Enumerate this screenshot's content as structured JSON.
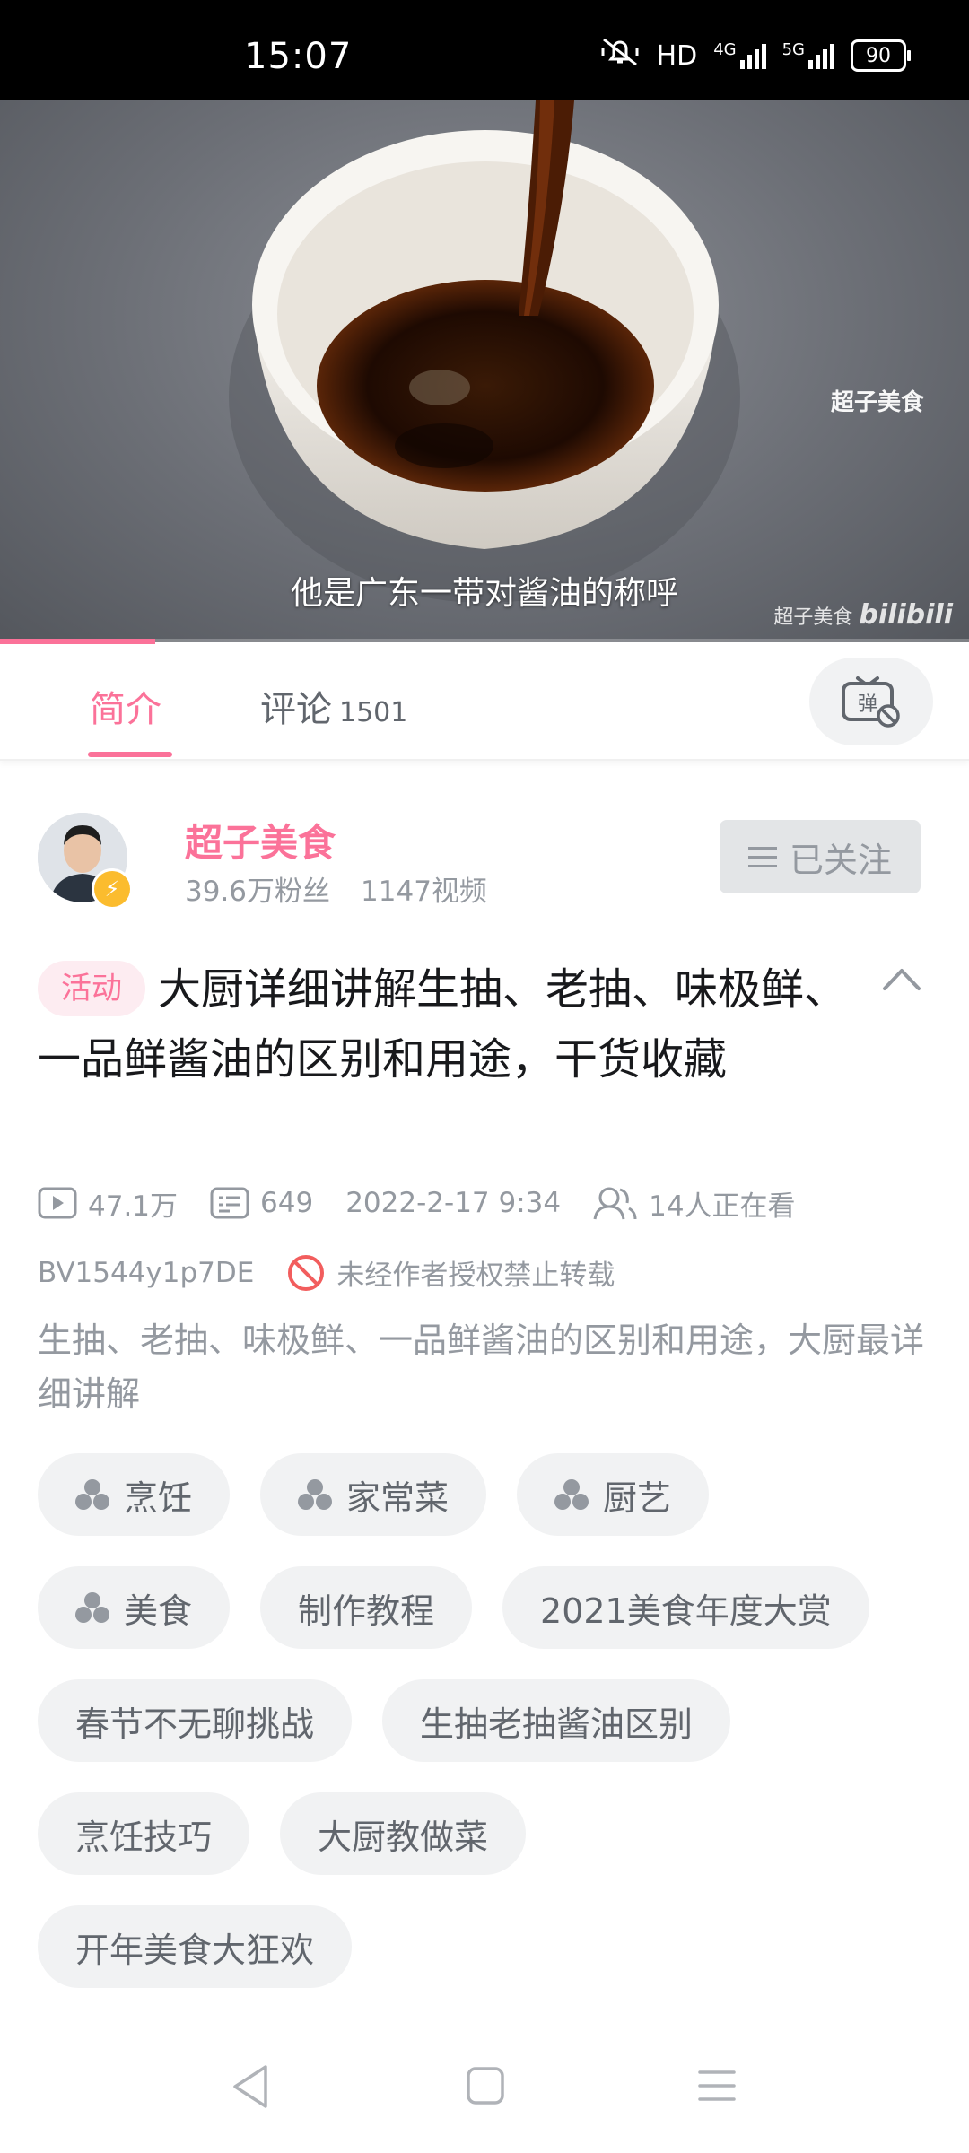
{
  "status_bar": {
    "time": "15:07",
    "hd_label": "HD",
    "network_4g": "4G",
    "network_5g": "5G",
    "battery": "90",
    "icons": [
      "mute-bell-icon",
      "hd-icon",
      "signal-4g-icon",
      "signal-5g-icon",
      "battery-icon"
    ]
  },
  "video": {
    "subtitle": "他是广东一带对酱油的称呼",
    "watermark_top": "超子美食",
    "watermark_bottom_text": "超子美食",
    "watermark_bottom_logo": "bilibili",
    "progress_fraction": 0.16
  },
  "tabs": {
    "intro": "简介",
    "comments": "评论",
    "comments_count": "1501",
    "danmaku_icon": "danmaku-off-icon"
  },
  "uploader": {
    "name": "超子美食",
    "fans": "39.6万粉丝",
    "videos": "1147视频",
    "follow_label": "已关注"
  },
  "video_info": {
    "badge": "活动",
    "title": "大厨详细讲解生抽、老抽、味极鲜、一品鲜酱油的区别和用途，干货收藏",
    "plays": "47.1万",
    "danmaku": "649",
    "date": "2022-2-17 9:34",
    "watching": "14人正在看",
    "bvid": "BV1544y1p7DE",
    "repost_notice": "未经作者授权禁止转载",
    "description": "生抽、老抽、味极鲜、一品鲜酱油的区别和用途，大厨最详细讲解"
  },
  "tags": [
    [
      "烹饪",
      "家常菜",
      "厨艺"
    ],
    [
      "美食",
      "制作教程",
      "2021美食年度大赏"
    ],
    [
      "春节不无聊挑战",
      "生抽老抽酱油区别"
    ],
    [
      "烹饪技巧",
      "大厨教做菜"
    ],
    [
      "开年美食大狂欢"
    ]
  ],
  "accent_color": "#fb7299"
}
